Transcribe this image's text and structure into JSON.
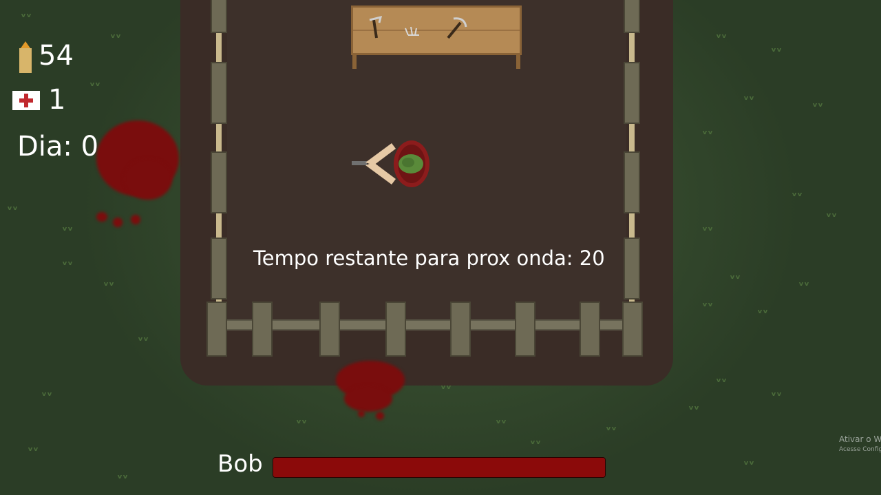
{
  "hud": {
    "ammo_count": "54",
    "medkit_count": "1",
    "day_label": "Dia: 0"
  },
  "wave": {
    "timer_text": "Tempo restante para prox onda: 20"
  },
  "player": {
    "name": "Bob",
    "health_fraction": 1.0
  },
  "watermark": {
    "line1": "Ativar o W",
    "line2": "Acesse Config"
  },
  "colors": {
    "health": "#8b0a0a",
    "ammo": "#d8b56a",
    "medkit_cross": "#c0282d",
    "blood": "#7a0d0d"
  },
  "icons": [
    "ammo-icon",
    "medkit-icon",
    "crafting-table",
    "player-character"
  ]
}
